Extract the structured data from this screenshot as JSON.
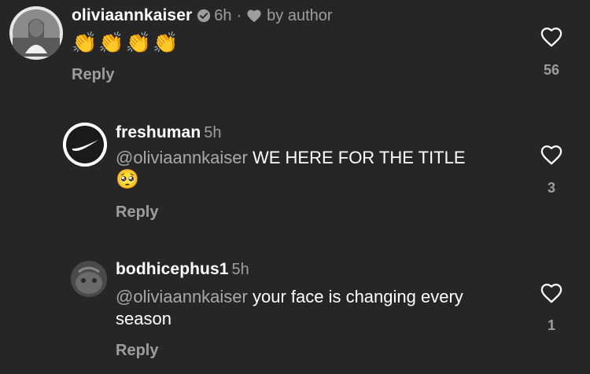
{
  "comments": [
    {
      "username": "oliviaannkaiser",
      "time": "6h",
      "separator": "·",
      "author_badge": "by author",
      "verified": true,
      "emoji": "👏👏👏👏",
      "reply_label": "Reply",
      "like_count": "56"
    },
    {
      "username": "freshuman",
      "time": "5h",
      "mention": "@oliviaannkaiser",
      "text": " WE HERE FOR THE TITLE",
      "emoji": "🥺",
      "reply_label": "Reply",
      "like_count": "3"
    },
    {
      "username": "bodhicephus1",
      "time": "5h",
      "mention": "@oliviaannkaiser",
      "text": " your face is changing every season",
      "reply_label": "Reply",
      "like_count": "1"
    }
  ],
  "icons": {
    "like": "heart-outline-icon",
    "verified": "verified-badge-icon",
    "author_heart": "heart-filled-icon"
  },
  "colors": {
    "background": "#262626",
    "text_primary": "#ffffff",
    "text_secondary": "#9e9e9e"
  }
}
